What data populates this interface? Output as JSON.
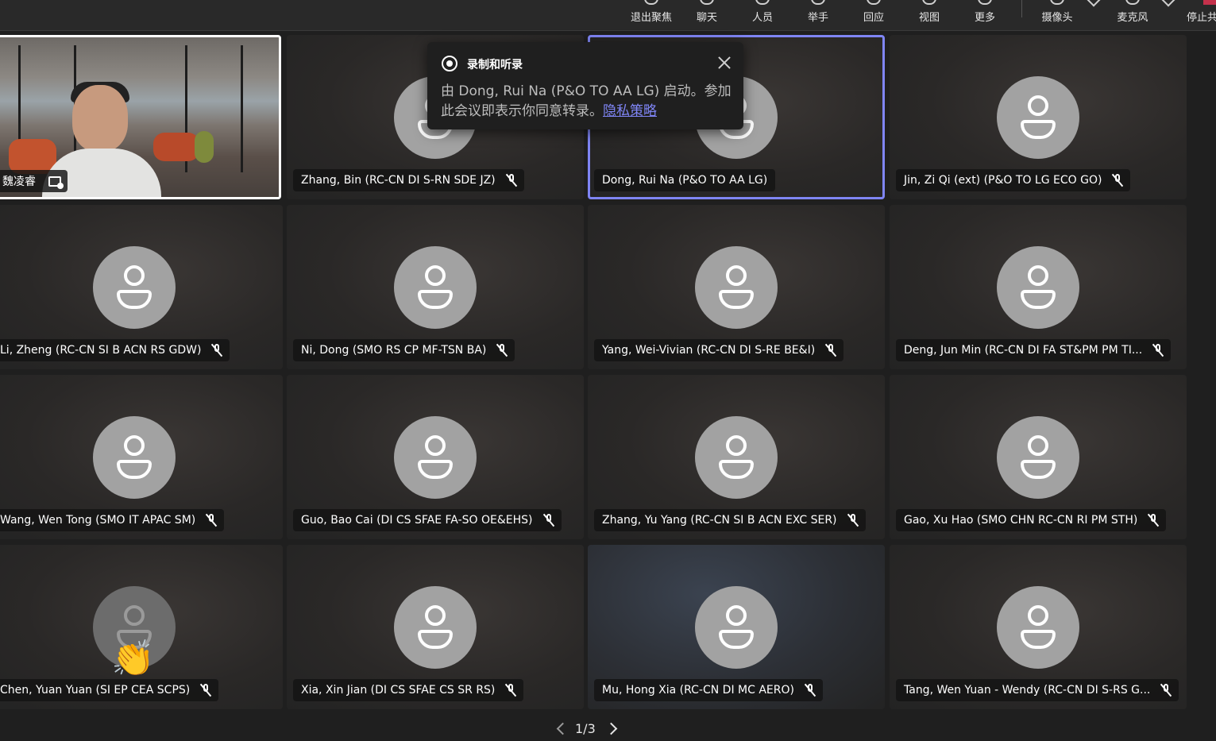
{
  "toolbar": {
    "items": [
      {
        "label": "退出聚焦",
        "icon": "exit-focus-icon"
      },
      {
        "label": "聊天",
        "icon": "chat-icon"
      },
      {
        "label": "人员",
        "icon": "people-icon"
      },
      {
        "label": "举手",
        "icon": "raise-hand-icon"
      },
      {
        "label": "回应",
        "icon": "react-icon"
      },
      {
        "label": "视图",
        "icon": "view-icon"
      },
      {
        "label": "更多",
        "icon": "more-icon"
      },
      {
        "label": "摄像头",
        "icon": "camera-icon"
      },
      {
        "label": "麦克风",
        "icon": "microphone-icon"
      },
      {
        "label": "停止共",
        "icon": "stop-share-icon"
      }
    ]
  },
  "self_tile": {
    "name": "魏凌睿",
    "icon": "screen-share-icon"
  },
  "participants": [
    {
      "name": "Zhang, Bin (RC-CN DI S-RN SDE JZ)",
      "muted": true
    },
    {
      "name": "Dong, Rui Na (P&O TO AA LG)",
      "muted": false,
      "speaking": true
    },
    {
      "name": "Jin, Zi Qi (ext) (P&O TO LG ECO GO)",
      "muted": true
    },
    {
      "name": "Li, Zheng (RC-CN SI B ACN RS GDW)",
      "muted": true
    },
    {
      "name": "Ni, Dong (SMO RS CP MF-TSN BA)",
      "muted": true
    },
    {
      "name": "Yang, Wei-Vivian (RC-CN DI S-RE BE&I)",
      "muted": true
    },
    {
      "name": "Deng, Jun Min (RC-CN DI FA ST&PM PM TI...",
      "muted": true
    },
    {
      "name": "Wang, Wen Tong (SMO IT APAC SM)",
      "muted": true
    },
    {
      "name": "Guo, Bao Cai (DI CS SFAE FA-SO OE&EHS)",
      "muted": true
    },
    {
      "name": "Zhang, Yu Yang (RC-CN SI B ACN EXC SER)",
      "muted": true
    },
    {
      "name": "Gao, Xu Hao (SMO CHN RC-CN RI PM STH)",
      "muted": true
    },
    {
      "name": "Chen, Yuan Yuan (SI EP CEA SCPS)",
      "muted": true,
      "reaction": "👏"
    },
    {
      "name": "Xia, Xin Jian (DI CS SFAE CS SR RS)",
      "muted": true
    },
    {
      "name": "Mu, Hong Xia (RC-CN DI MC AERO)",
      "muted": true
    },
    {
      "name": "Tang, Wen Yuan - Wendy (RC-CN DI S-RS G...",
      "muted": true
    }
  ],
  "recording_popup": {
    "title": "录制和听录",
    "body": "由 Dong, Rui Na (P&O TO AA LG) 启动。参加此会议即表示你同意转录。",
    "link": "隐私策略"
  },
  "pager": {
    "text": "1/3"
  },
  "colors": {
    "accent": "#7f85f5",
    "background": "#1f1f1f",
    "avatar": "#a2a2a2"
  }
}
